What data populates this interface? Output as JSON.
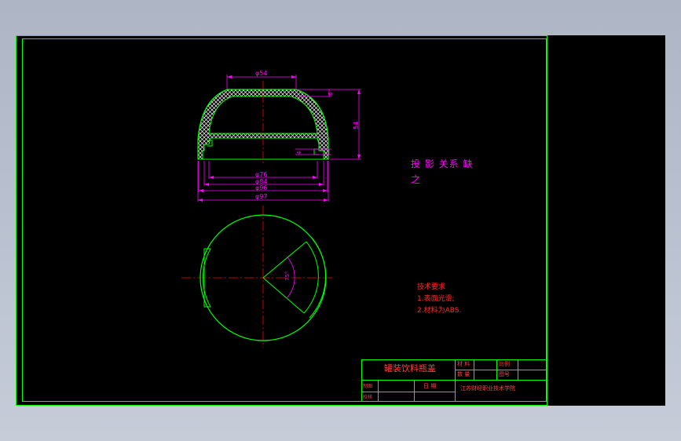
{
  "colors": {
    "background": "#000000",
    "frame": "#00ff00",
    "dimension": "#ff00ff",
    "centerline": "#ff0000",
    "hatch": "#ffffff",
    "title_text": "#ff3030"
  },
  "dimensions": {
    "top_dia": "φ54",
    "dia_76": "φ76",
    "dia_84": "φ84",
    "dia_96": "φ96",
    "dia_97": "φ97",
    "height": "54",
    "rim": "6",
    "groove": "4",
    "angle": "75°"
  },
  "note": {
    "line1": "投 影 关系 缺",
    "line2": "之"
  },
  "tech": {
    "title": "技术要求",
    "item1": "1.表面光滑;",
    "item2": "2.材料为ABS."
  },
  "titleblock": {
    "part_name": "罐装饮料瓶盖",
    "material_label": "材 料",
    "quantity_label": "数 量",
    "scale_label": "比例",
    "drawing_no_label": "图号",
    "drawn_label": "制图",
    "checked_label": "校核",
    "date_label": "日 期",
    "school": "江苏财经职业技术学院"
  }
}
